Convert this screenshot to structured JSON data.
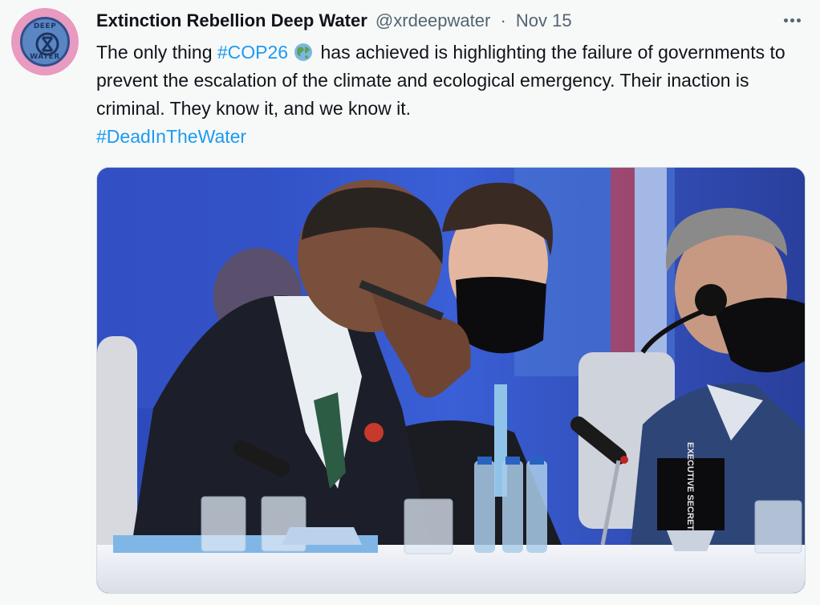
{
  "tweet": {
    "display_name": "Extinction Rebellion Deep Water",
    "handle": "@xrdeepwater",
    "separator": "·",
    "timestamp": "Nov 15",
    "avatar_top_text": "DEEP",
    "avatar_bottom_text": "WATER",
    "text_part1": "The only thing ",
    "hashtag1": "#COP26",
    "text_part2": " has achieved is highlighting the failure of governments to prevent the escalation of the climate and ecological emergency. Their inaction is criminal. They know it, and we know it.",
    "hashtag2": "#DeadInTheWater",
    "emoji": "globe-icon",
    "media_sign_text": "EXECUTIVE SECRETARY"
  },
  "colors": {
    "link": "#1d9bf0",
    "secondary_text": "#536471",
    "background": "#f7f9f9",
    "avatar_ring": "#e89ac0"
  }
}
